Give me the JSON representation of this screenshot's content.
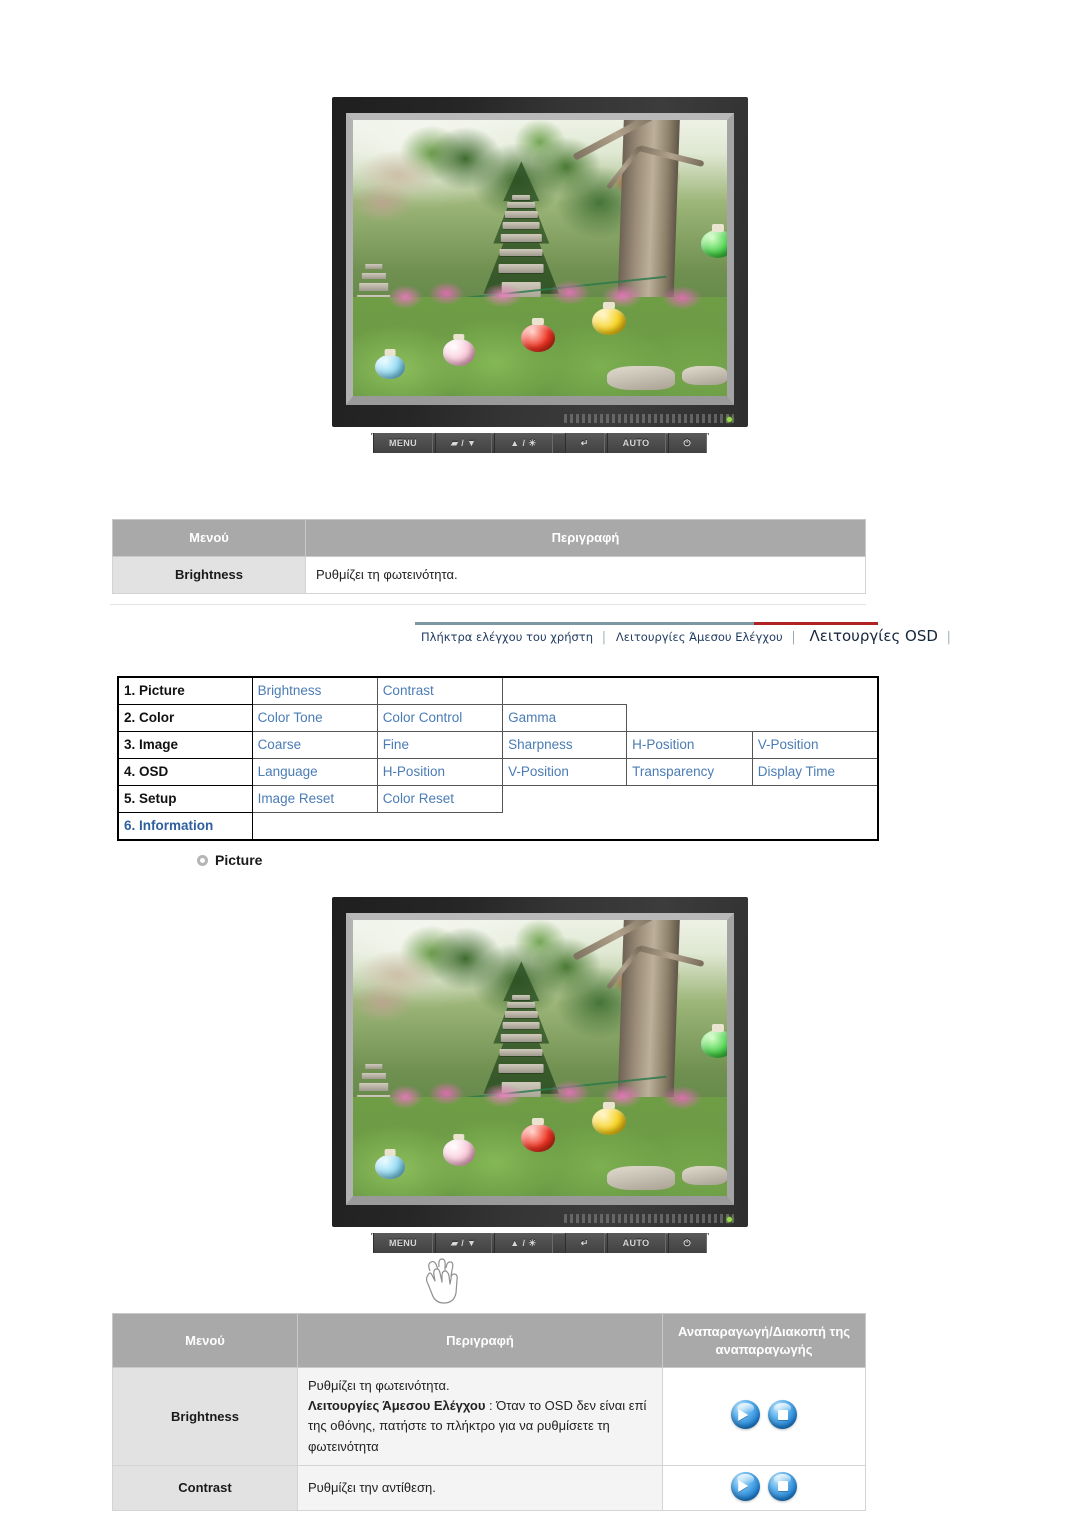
{
  "page": {
    "background": "#ffffff"
  },
  "monitor": {
    "controls": [
      {
        "name": "menu-button",
        "label": "MENU"
      },
      {
        "name": "brightness-down-button",
        "label": "▰ / ▼"
      },
      {
        "name": "brightness-up-button",
        "label": "▲ / ☀"
      },
      {
        "name": "enter-source-button",
        "label": "↵"
      },
      {
        "name": "auto-button",
        "label": "AUTO"
      },
      {
        "name": "power-button",
        "label": "⏻"
      }
    ],
    "screen_scene": "garden with stone pagoda, trees and colored paper lanterns"
  },
  "summary_table": {
    "headers": [
      "Μενού",
      "Περιγραφή"
    ],
    "rows": [
      {
        "menu": "Brightness",
        "description": "Ρυθμίζει τη φωτεινότητα."
      }
    ]
  },
  "nav": {
    "items": [
      {
        "label": "Πλήκτρα ελέγχου του χρήστη",
        "current": false
      },
      {
        "label": "Λειτουργίες Άμεσου Ελέγχου",
        "current": false
      },
      {
        "label": "Λειτουργίες OSD",
        "current": true
      }
    ],
    "separator": "│",
    "rule_color": "#7b98a3",
    "accent_color": "#b22222"
  },
  "osd_map": {
    "rows": [
      {
        "group": "1. Picture",
        "group_highlight": false,
        "items": [
          "Brightness",
          "Contrast"
        ]
      },
      {
        "group": "2. Color",
        "group_highlight": false,
        "items": [
          "Color Tone",
          "Color Control",
          "Gamma"
        ]
      },
      {
        "group": "3. Image",
        "group_highlight": false,
        "items": [
          "Coarse",
          "Fine",
          "Sharpness",
          "H-Position",
          "V-Position"
        ]
      },
      {
        "group": "4. OSD",
        "group_highlight": false,
        "items": [
          "Language",
          "H-Position",
          "V-Position",
          "Transparency",
          "Display Time"
        ]
      },
      {
        "group": "5. Setup",
        "group_highlight": false,
        "items": [
          "Image Reset",
          "Color Reset"
        ]
      },
      {
        "group": "6. Information",
        "group_highlight": true,
        "items": []
      }
    ],
    "max_columns": 5,
    "group_color": "#111111",
    "item_color": "#4a7cb5",
    "highlight_color": "#2f5f9e"
  },
  "section_heading": {
    "label": "Picture",
    "bullet": "ring-bullet-icon"
  },
  "detail_table": {
    "headers": [
      "Μενού",
      "Περιγραφή",
      "Αναπαραγωγή/Διακοπή της αναπαραγωγής"
    ],
    "rows": [
      {
        "menu": "Brightness",
        "desc_line1": "Ρυθμίζει τη φωτεινότητα.",
        "desc_bold": "Λειτουργίες Άμεσου Ελέγχου",
        "desc_rest": " : Όταν το OSD δεν είναι επί της οθόνης, πατήστε το πλήκτρο για να ρυθμίσετε τη φωτεινότητα",
        "icons": [
          "play-icon",
          "stop-icon"
        ]
      },
      {
        "menu": "Contrast",
        "desc_line1": "Ρυθμίζει την αντίθεση.",
        "desc_bold": "",
        "desc_rest": "",
        "icons": [
          "play-icon",
          "stop-icon"
        ]
      }
    ]
  }
}
